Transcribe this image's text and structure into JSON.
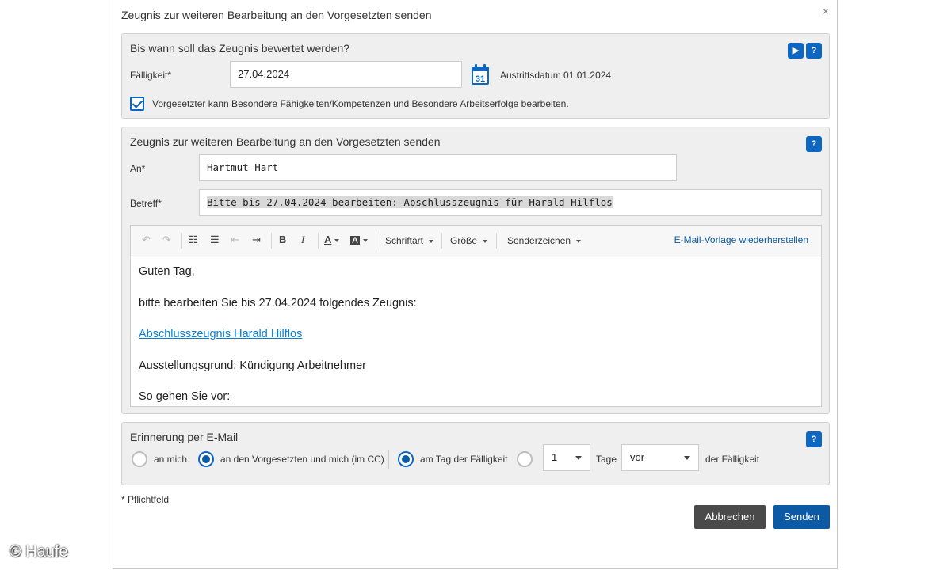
{
  "dialog": {
    "title": "Zeugnis zur weiteren Bearbeitung an den Vorgesetzten senden",
    "close_glyph": "×"
  },
  "deadline": {
    "title": "Bis wann soll das Zeugnis bewertet werden?",
    "play_glyph": "▶",
    "help_glyph": "?",
    "due_label": "Fälligkeit*",
    "due_value": "27.04.2024",
    "calendar_day": "31",
    "exit_date": "Austrittsdatum 01.01.2024",
    "checkbox_checked": true,
    "checkbox_label": "Vorgesetzter kann Besondere Fähigkeiten/Kompetenzen und Besondere Arbeitserfolge bearbeiten."
  },
  "send": {
    "title": "Zeugnis zur weiteren Bearbeitung an den Vorgesetzten senden",
    "help_glyph": "?",
    "to_label": "An*",
    "to_value": "Hartmut Hart",
    "subject_label": "Betreff*",
    "subject_value": "Bitte bis 27.04.2024 bearbeiten: Abschlusszeugnis für Harald Hilflos"
  },
  "toolbar": {
    "undo": "↶",
    "redo": "↷",
    "ordered_list": "☷",
    "bullet_list": "☰",
    "outdent": "⇤",
    "indent": "⇥",
    "bold": "B",
    "italic": "I",
    "font_color": "A",
    "bg_color": "A",
    "font": "Schriftart",
    "size": "Größe",
    "special_chars": "Sonderzeichen",
    "restore_template": "E-Mail-Vorlage wiederherstellen"
  },
  "body": {
    "greeting": "Guten Tag,",
    "line1": "bitte bearbeiten Sie bis 27.04.2024 folgendes Zeugnis:",
    "link": "Abschlusszeugnis Harald Hilflos",
    "reason": "Ausstellungsgrund: Kündigung Arbeitnehmer",
    "next": "So gehen Sie vor:"
  },
  "reminder": {
    "title": "Erinnerung per E-Mail",
    "help_glyph": "?",
    "opt_me": "an mich",
    "opt_sup": "an den Vorgesetzten und mich (im CC)",
    "opt_dueday": "am Tag der Fälligkeit",
    "days_value": "1",
    "days_label": "Tage",
    "before_value": "vor",
    "due_suffix": "der Fälligkeit",
    "selected_recipient": "an den Vorgesetzten und mich (im CC)",
    "selected_timing": "am Tag der Fälligkeit"
  },
  "footer": {
    "required_note": "* Pflichtfeld",
    "cancel": "Abbrechen",
    "send": "Senden"
  },
  "watermark": "© Haufe",
  "colors": {
    "accent": "#0c66c2",
    "cancel_button": "#4a4a4a",
    "send_button": "#0c5aa6",
    "link": "#0a7fd0"
  }
}
